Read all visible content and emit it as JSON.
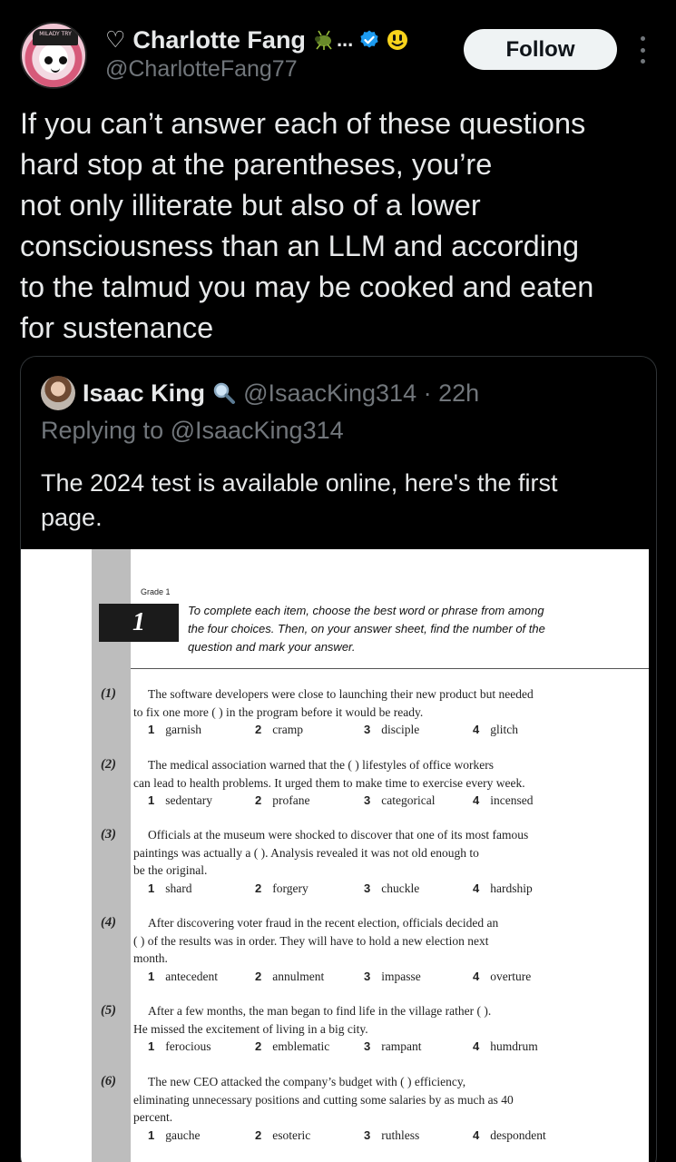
{
  "header": {
    "name": "Charlotte Fang",
    "heart": "♡",
    "ellipsis": "...",
    "handle": "@CharlotteFang77",
    "follow_label": "Follow",
    "avatar_hat_text": "MILADY TRY"
  },
  "post": {
    "lines": [
      "If you can’t answer each of these questions",
      "hard stop at the parentheses, you’re",
      "not only illiterate but also of a lower",
      "consciousness than an LLM and according",
      "to the talmud you may be cooked and eaten",
      "for sustenance"
    ]
  },
  "quote": {
    "name": "Isaac King",
    "handle_time": "@IsaacKing314 · 22h",
    "reply": "Replying to @IsaacKing314",
    "text_lines": [
      "The 2024 test is available online, here's the first",
      "page."
    ]
  },
  "scan": {
    "grade": "Grade 1",
    "section_num": "1",
    "instructions": [
      "To complete each item, choose the best word or phrase from among",
      "the four choices. Then, on your answer sheet, find the number of the",
      "question and mark your answer."
    ],
    "items": [
      {
        "num": "(1)",
        "lines": [
          "The software developers were close to launching their new product but needed",
          "to fix one more (                 ) in the program before it would be ready."
        ],
        "choices": [
          {
            "n": "1",
            "w": "garnish"
          },
          {
            "n": "2",
            "w": "cramp"
          },
          {
            "n": "3",
            "w": "disciple"
          },
          {
            "n": "4",
            "w": "glitch"
          }
        ]
      },
      {
        "num": "(2)",
        "lines": [
          "The medical association warned that the (                 ) lifestyles of office workers",
          "can lead to health problems. It urged them to make time to exercise every week."
        ],
        "choices": [
          {
            "n": "1",
            "w": "sedentary"
          },
          {
            "n": "2",
            "w": "profane"
          },
          {
            "n": "3",
            "w": "categorical"
          },
          {
            "n": "4",
            "w": "incensed"
          }
        ]
      },
      {
        "num": "(3)",
        "lines": [
          "Officials at the museum were shocked to discover that one of its most famous",
          "paintings was actually a (                 ). Analysis revealed it was not old enough to",
          "be the original."
        ],
        "choices": [
          {
            "n": "1",
            "w": "shard"
          },
          {
            "n": "2",
            "w": "forgery"
          },
          {
            "n": "3",
            "w": "chuckle"
          },
          {
            "n": "4",
            "w": "hardship"
          }
        ]
      },
      {
        "num": "(4)",
        "lines": [
          "After discovering voter fraud in the recent election, officials decided an",
          "(                 ) of the results was in order. They will have to hold a new election next",
          "month."
        ],
        "choices": [
          {
            "n": "1",
            "w": "antecedent"
          },
          {
            "n": "2",
            "w": "annulment"
          },
          {
            "n": "3",
            "w": "impasse"
          },
          {
            "n": "4",
            "w": "overture"
          }
        ]
      },
      {
        "num": "(5)",
        "lines": [
          "After a few months, the man began to find life in the village rather (                 ).",
          "He missed the excitement of living in a big city."
        ],
        "choices": [
          {
            "n": "1",
            "w": "ferocious"
          },
          {
            "n": "2",
            "w": "emblematic"
          },
          {
            "n": "3",
            "w": "rampant"
          },
          {
            "n": "4",
            "w": "humdrum"
          }
        ]
      },
      {
        "num": "(6)",
        "lines": [
          "The new CEO attacked the company’s budget with (                 ) efficiency,",
          "eliminating unnecessary positions and cutting some salaries by as much as 40",
          "percent."
        ],
        "choices": [
          {
            "n": "1",
            "w": "gauche"
          },
          {
            "n": "2",
            "w": "esoteric"
          },
          {
            "n": "3",
            "w": "ruthless"
          },
          {
            "n": "4",
            "w": "despondent"
          }
        ]
      }
    ]
  },
  "colors": {
    "background": "#000000",
    "text": "#e7e9ea",
    "muted": "#71767b",
    "verified": "#1d9bf0",
    "follow_bg": "#eff3f4"
  }
}
